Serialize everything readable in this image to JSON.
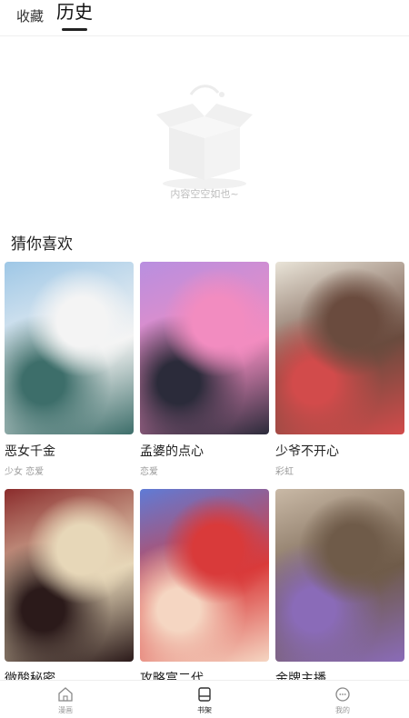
{
  "header": {
    "tabs": [
      {
        "label": "收藏"
      },
      {
        "label": "历史"
      }
    ]
  },
  "empty_state": {
    "text": "内容空空如也~"
  },
  "recommend": {
    "title": "猜你喜欢",
    "items": [
      {
        "title": "恶女千金",
        "tags": "少女 恋爱",
        "colors": [
          "#9ec7e6",
          "#f4f4f4",
          "#3d6e6a"
        ]
      },
      {
        "title": "孟婆的点心",
        "tags": "恋爱",
        "colors": [
          "#b88fe0",
          "#f28cc0",
          "#2b2b3a"
        ]
      },
      {
        "title": "少爷不开心",
        "tags": "彩虹",
        "colors": [
          "#e9e4d8",
          "#6a4b3e",
          "#d24b4b"
        ]
      },
      {
        "title": "微酸秘密",
        "tags": "",
        "colors": [
          "#8b2c2c",
          "#e7d7b8",
          "#2b1a1a"
        ]
      },
      {
        "title": "攻略富二代",
        "tags": "",
        "colors": [
          "#5f7bd6",
          "#d93a3a",
          "#f5d6c2"
        ]
      },
      {
        "title": "金牌主播",
        "tags": "",
        "colors": [
          "#c9b9a6",
          "#6f5b49",
          "#8a6bb8"
        ]
      }
    ]
  },
  "bottom_nav": {
    "items": [
      {
        "label": "漫画",
        "icon": "home-icon"
      },
      {
        "label": "书架",
        "icon": "bookshelf-icon"
      },
      {
        "label": "我的",
        "icon": "profile-icon"
      }
    ]
  }
}
